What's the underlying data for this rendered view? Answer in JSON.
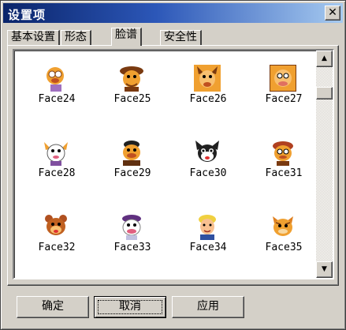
{
  "window": {
    "title": "设置项",
    "close_label": "✕"
  },
  "tabs": [
    {
      "label": "基本设置"
    },
    {
      "label": "形态"
    },
    {
      "label": "脸谱",
      "active": true
    },
    {
      "label": "安全性"
    }
  ],
  "faces": [
    {
      "label": "Face24"
    },
    {
      "label": "Face25"
    },
    {
      "label": "Face26"
    },
    {
      "label": "Face27"
    },
    {
      "label": "Face28"
    },
    {
      "label": "Face29"
    },
    {
      "label": "Face30"
    },
    {
      "label": "Face31"
    },
    {
      "label": "Face32"
    },
    {
      "label": "Face33"
    },
    {
      "label": "Face34"
    },
    {
      "label": "Face35"
    }
  ],
  "scrollbar": {
    "up_icon": "scroll-up-arrow",
    "down_icon": "scroll-down-arrow",
    "up_glyph": "▲",
    "down_glyph": "▼"
  },
  "buttons": {
    "ok": "确定",
    "cancel": "取消",
    "apply": "应用"
  },
  "colors": {
    "face_orange": "#f0a030",
    "face_brown": "#7a3a10",
    "title_blue": "#0a246a"
  }
}
